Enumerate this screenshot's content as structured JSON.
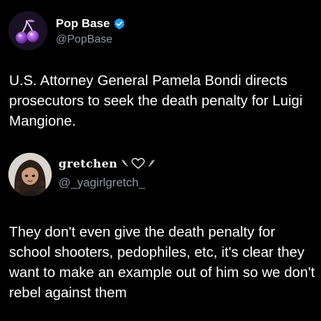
{
  "tweet_main": {
    "display_name": "Pop Base",
    "handle": "@PopBase",
    "verified": true,
    "avatar_icon": "cherries-icon",
    "body": "U.S. Attorney General Pamela Bondi directs prosecutors to seek the death penalty for Luigi Mangione."
  },
  "tweet_reply": {
    "display_name": "gretchen",
    "handle": "@_yagirlgretch_",
    "decoration_icon": "heart-with-leaves-icon",
    "avatar_icon": "illustrated-portrait-avatar",
    "body": "They don't even give the death penalty for school shooters, pedophiles, etc, it's clear they want to make an example out of him so we don't rebel against them"
  },
  "colors": {
    "background": "#000000",
    "text_primary": "#ffffff",
    "text_secondary": "#8b98a5",
    "verified_blue": "#1d9bf0"
  }
}
